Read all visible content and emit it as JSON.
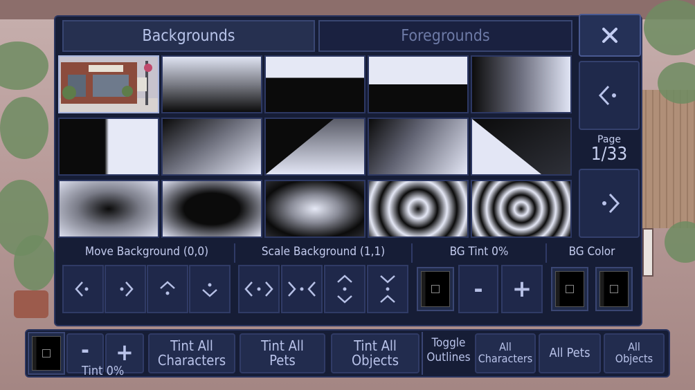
{
  "tabs": {
    "backgrounds": "Backgrounds",
    "foregrounds": "Foregrounds"
  },
  "close": {
    "icon": "close-icon",
    "label": "X"
  },
  "pager": {
    "label": "Page",
    "value": "1/33",
    "prev_icon": "chevron-left-icon",
    "next_icon": "chevron-right-icon"
  },
  "background_tiles": [
    {
      "kind": "coffee-shop-photo",
      "selected": true
    },
    {
      "kind": "vertical-fade-dark-bottom"
    },
    {
      "kind": "hard-split-light-top"
    },
    {
      "kind": "hard-split-light-top-2"
    },
    {
      "kind": "horizontal-fade-dark-left"
    },
    {
      "kind": "hard-split-dark-left"
    },
    {
      "kind": "diagonal-fade"
    },
    {
      "kind": "triangle-light"
    },
    {
      "kind": "diagonal-fade-dark-top-left"
    },
    {
      "kind": "trapezoid-dark"
    },
    {
      "kind": "radial-dark-center"
    },
    {
      "kind": "radial-dark-large"
    },
    {
      "kind": "radial-light-center"
    },
    {
      "kind": "rings"
    },
    {
      "kind": "rings-dense"
    }
  ],
  "sections": {
    "move": "Move Background (0,0)",
    "scale": "Scale Background (1,1)",
    "tint": "BG Tint 0%",
    "color": "BG Color"
  },
  "controls": {
    "minus": "-",
    "plus": "+"
  },
  "bottom": {
    "tint_label": "Tint 0%",
    "minus": "-",
    "plus": "+",
    "tint_all_characters": "Tint All\nCharacters",
    "tint_all_pets": "Tint All\nPets",
    "tint_all_objects": "Tint All\nObjects",
    "toggle_outlines": "Toggle\nOutlines",
    "all_characters": "All\nCharacters",
    "all_pets": "All Pets",
    "all_objects": "All\nObjects"
  },
  "colors": {
    "panel": "#161d36",
    "button": "#1f284a",
    "accent": "#7250b8",
    "text": "#c3cbee"
  }
}
